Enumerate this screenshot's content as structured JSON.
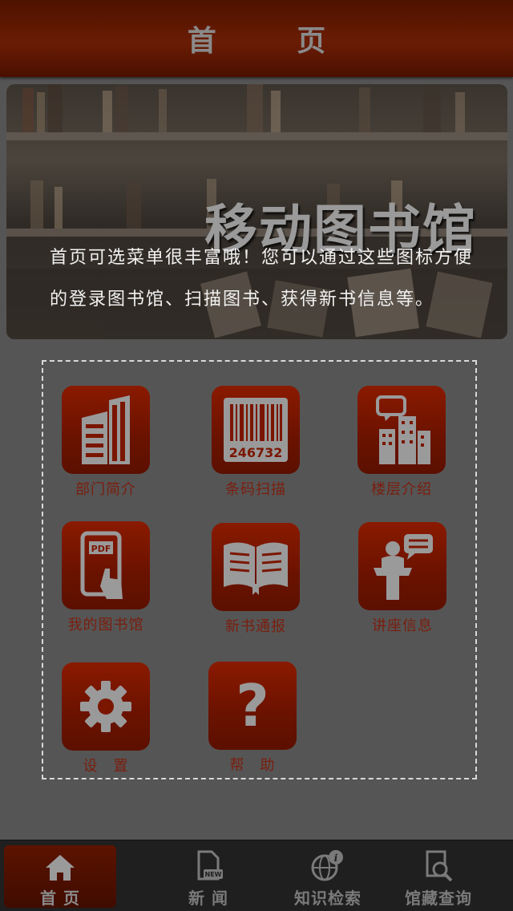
{
  "header": {
    "title": "首 页"
  },
  "banner": {
    "logo_text": "移动图书馆",
    "intro": "首页可选菜单很丰富哦！您可以通过这些图标方便的登录图书馆、扫描图书、获得新书信息等。"
  },
  "menu": {
    "items": [
      {
        "label": "部门简介",
        "icon": "buildings-icon"
      },
      {
        "label": "条码扫描",
        "icon": "barcode-icon",
        "barcode_number": "246732"
      },
      {
        "label": "楼层介绍",
        "icon": "building-speech-icon"
      },
      {
        "label": "我的图书馆",
        "icon": "pdf-tablet-icon"
      },
      {
        "label": "新书通报",
        "icon": "open-book-icon"
      },
      {
        "label": "讲座信息",
        "icon": "lecture-icon"
      },
      {
        "label": "设　置",
        "icon": "gear-icon"
      },
      {
        "label": "帮　助",
        "icon": "question-icon"
      }
    ]
  },
  "tabbar": {
    "tabs": [
      {
        "label": "首 页",
        "icon": "home-icon",
        "active": true
      },
      {
        "label": "新 闻",
        "icon": "news-icon",
        "badge": "NEW",
        "active": false
      },
      {
        "label": "知识检索",
        "icon": "globe-info-icon",
        "active": false
      },
      {
        "label": "馆藏查询",
        "icon": "search-document-icon",
        "active": false
      }
    ]
  },
  "colors": {
    "header_bg": "#5a1602",
    "tile_bg": "#7a1600",
    "tile_label": "#7a1e0e",
    "page_bg": "#555555",
    "tabbar_bg": "#1f1f1f"
  }
}
